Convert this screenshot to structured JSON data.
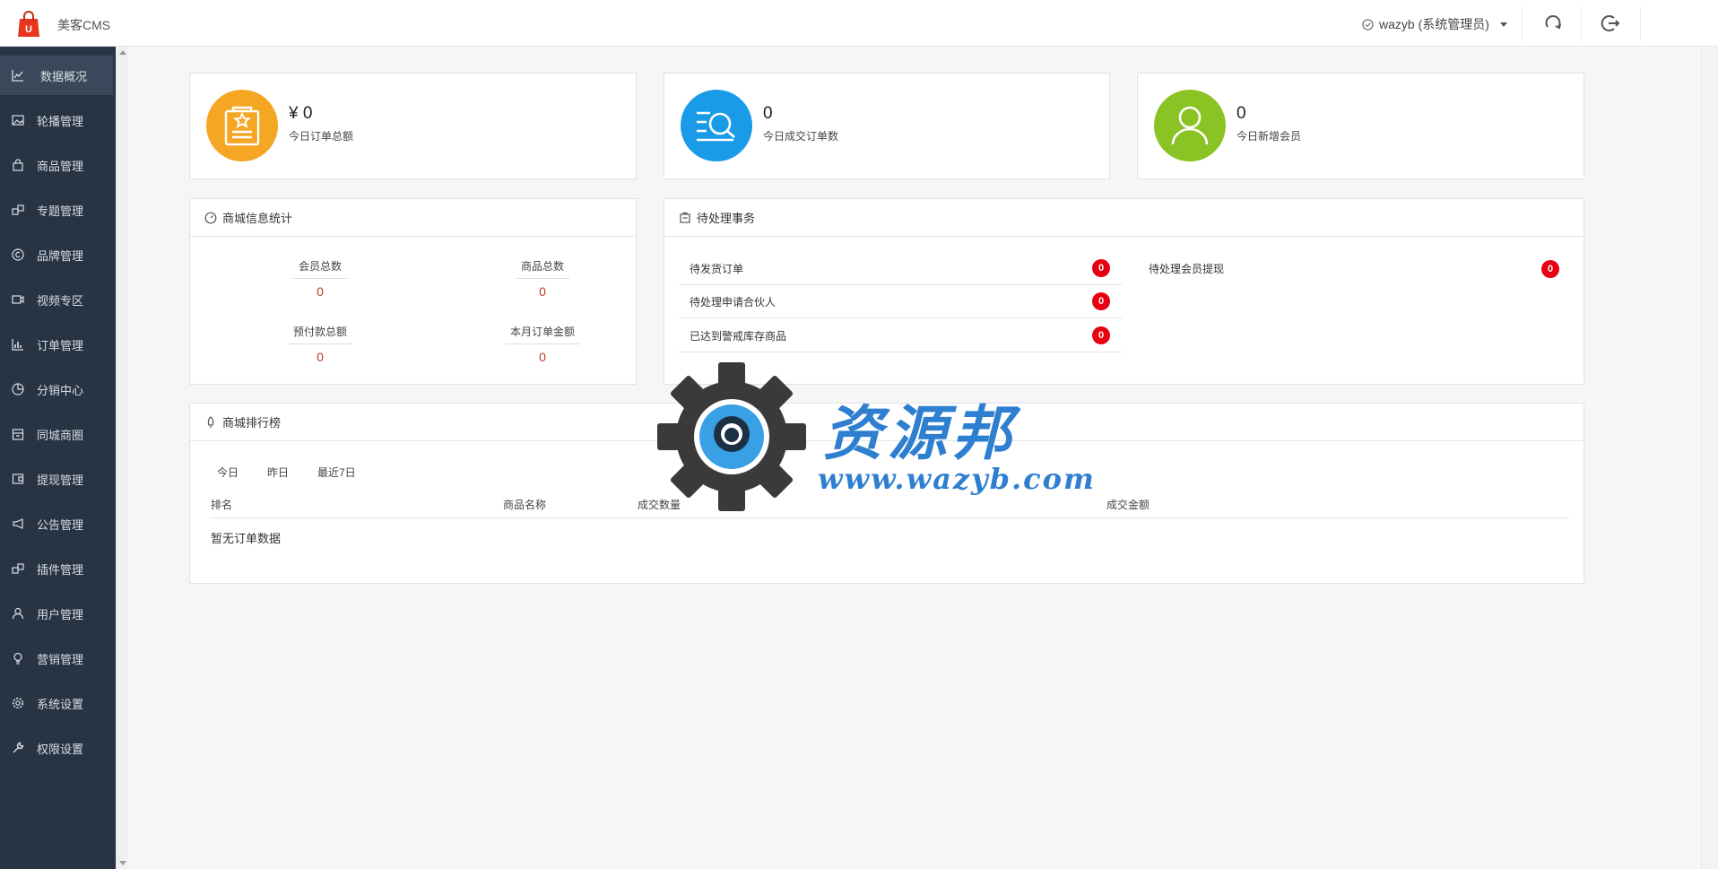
{
  "header": {
    "app_title": "美客CMS",
    "user": "wazyb (系统管理员)"
  },
  "sidebar": {
    "items": [
      {
        "label": "数据概况",
        "icon": "line-chart-icon",
        "active": true
      },
      {
        "label": "轮播管理",
        "icon": "image-icon"
      },
      {
        "label": "商品管理",
        "icon": "bag-icon"
      },
      {
        "label": "专题管理",
        "icon": "puzzle-icon"
      },
      {
        "label": "品牌管理",
        "icon": "copyright-icon"
      },
      {
        "label": "视频专区",
        "icon": "video-icon"
      },
      {
        "label": "订单管理",
        "icon": "bar-chart-icon"
      },
      {
        "label": "分销中心",
        "icon": "pie-chart-icon"
      },
      {
        "label": "同城商圈",
        "icon": "store-icon"
      },
      {
        "label": "提现管理",
        "icon": "wallet-icon"
      },
      {
        "label": "公告管理",
        "icon": "megaphone-icon"
      },
      {
        "label": "插件管理",
        "icon": "plugin-icon"
      },
      {
        "label": "用户管理",
        "icon": "user-icon"
      },
      {
        "label": "营销管理",
        "icon": "bulb-icon"
      },
      {
        "label": "系统设置",
        "icon": "gear-icon"
      },
      {
        "label": "权限设置",
        "icon": "wrench-icon"
      }
    ]
  },
  "stats": [
    {
      "value": "¥ 0",
      "label": "今日订单总额",
      "color": "#f5a623",
      "icon": "clipboard-star-icon"
    },
    {
      "value": "0",
      "label": "今日成交订单数",
      "color": "#1a9be8",
      "icon": "list-search-icon"
    },
    {
      "value": "0",
      "label": "今日新增会员",
      "color": "#8ac324",
      "icon": "user-icon"
    }
  ],
  "mall_info": {
    "title": "商城信息统计",
    "items": [
      {
        "label": "会员总数",
        "value": "0"
      },
      {
        "label": "商品总数",
        "value": "0"
      },
      {
        "label": "预付款总额",
        "value": "0"
      },
      {
        "label": "本月订单金额",
        "value": "0"
      }
    ]
  },
  "todo": {
    "title": "待处理事务",
    "left": [
      {
        "label": "待发货订单",
        "count": "0"
      },
      {
        "label": "待处理申请合伙人",
        "count": "0"
      },
      {
        "label": "已达到警戒库存商品",
        "count": "0"
      }
    ],
    "right": [
      {
        "label": "待处理会员提现",
        "count": "0"
      }
    ]
  },
  "ranking": {
    "title": "商城排行榜",
    "tabs": [
      "今日",
      "昨日",
      "最近7日"
    ],
    "columns": [
      "排名",
      "商品名称",
      "成交数量",
      "成交金额"
    ],
    "empty": "暂无订单数据"
  },
  "watermark": {
    "title": "资源邦",
    "url": "www.wazyb.com"
  }
}
